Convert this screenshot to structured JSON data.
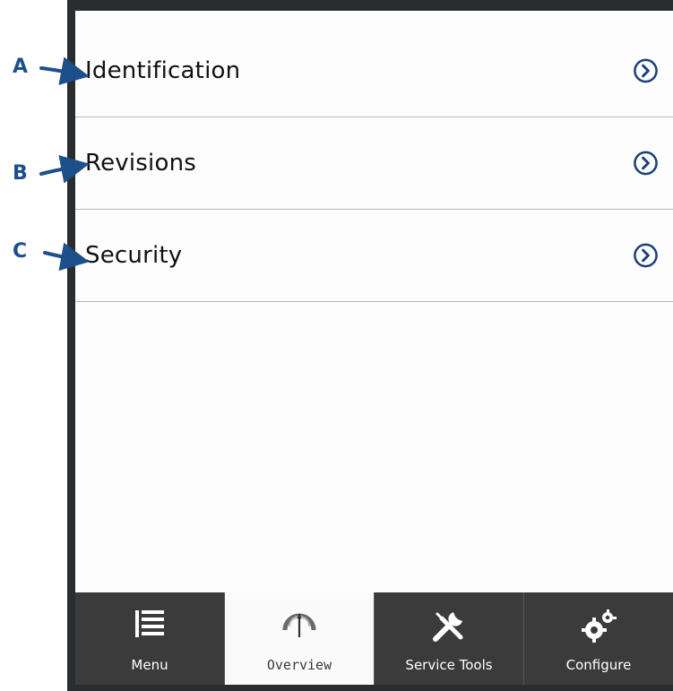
{
  "callouts": [
    {
      "letter": "A"
    },
    {
      "letter": "B"
    },
    {
      "letter": "C"
    }
  ],
  "list": {
    "items": [
      {
        "label": "Identification",
        "icon": "chevron-right-circle-icon"
      },
      {
        "label": "Revisions",
        "icon": "chevron-right-circle-icon"
      },
      {
        "label": "Security",
        "icon": "chevron-right-circle-icon"
      }
    ]
  },
  "tabbar": {
    "active": "Overview",
    "tabs": [
      {
        "label": "Menu",
        "icon": "menu-list-icon"
      },
      {
        "label": "Overview",
        "icon": "gauge-icon"
      },
      {
        "label": "Service Tools",
        "icon": "tools-icon"
      },
      {
        "label": "Configure",
        "icon": "gears-icon"
      }
    ]
  },
  "colors": {
    "callout": "#1d4f8a",
    "chevron": "#1c3f7a",
    "tabbar_bg": "#3b3b3b",
    "tab_active_bg": "#fafafa"
  }
}
